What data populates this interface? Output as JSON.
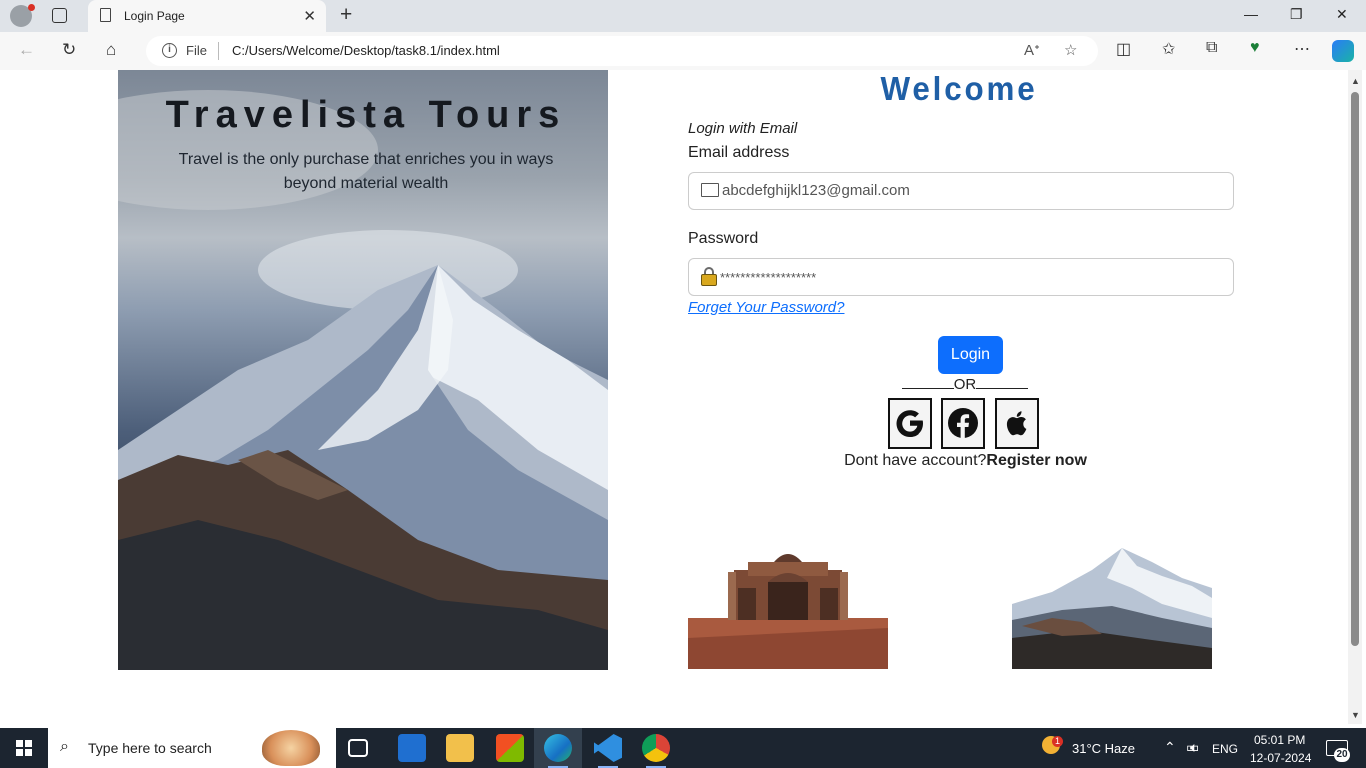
{
  "browser": {
    "tab_title": "Login Page",
    "tab_close": "✕",
    "new_tab": "+",
    "address_scheme_label": "File",
    "url": "C:/Users/Welcome/Desktop/task8.1/index.html",
    "window_minimize": "—",
    "window_restore": "❐",
    "window_close": "✕"
  },
  "page": {
    "hero_title": "Travelista Tours",
    "hero_subtitle": "Travel is the only purchase that enriches you in ways beyond material wealth",
    "welcome": "Welcome",
    "login_with": "Login with Email",
    "email_label": "Email address",
    "email_value": "abcdefghijkl123@gmail.com",
    "password_label": "Password",
    "password_value": "*******************",
    "forget_password": "Forget Your Password?",
    "login_button": "Login",
    "or_text": "OR",
    "register_prompt": "Dont have account?",
    "register_link": "Register now",
    "social_buttons": [
      "google-icon",
      "facebook-icon",
      "apple-icon"
    ]
  },
  "taskbar": {
    "search_placeholder": "Type here to search",
    "weather_badge": "1",
    "weather": "31°C  Haze",
    "language": "ENG",
    "time": "05:01 PM",
    "date": "12-07-2024",
    "notification_count": "20",
    "apps": [
      "task-view-icon",
      "mail-icon",
      "file-explorer-icon",
      "store-icon",
      "edge-icon",
      "vscode-icon",
      "chrome-icon"
    ]
  },
  "colors": {
    "accent": "#0d6efd",
    "welcome": "#1f5fa6",
    "taskbar": "#1c2530"
  }
}
